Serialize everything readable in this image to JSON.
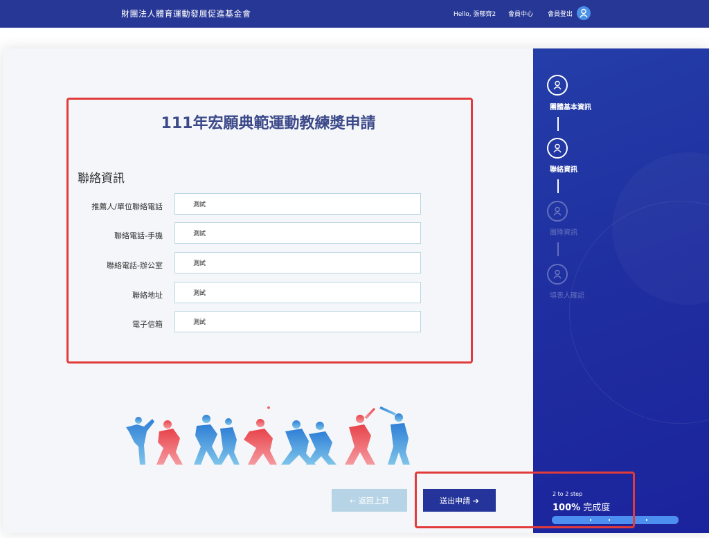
{
  "header": {
    "brand": "財團法人體育運動發展促進基金會",
    "greeting": "Hello, 張郁齊2",
    "member_center": "會員中心",
    "logout": "會員登出"
  },
  "form": {
    "title": "111年宏願典範運動教練獎申請",
    "section": "聯絡資訊",
    "fields": [
      {
        "label": "推薦人/單位聯絡電話",
        "value": "測試"
      },
      {
        "label": "聯絡電話-手機",
        "value": "測試"
      },
      {
        "label": "聯絡電話-辦公室",
        "value": "測試"
      },
      {
        "label": "聯絡地址",
        "value": "測試"
      },
      {
        "label": "電子信箱",
        "value": "測試"
      }
    ]
  },
  "buttons": {
    "back": "← 返回上頁",
    "submit": "送出申請 ➔"
  },
  "steps": [
    {
      "label": "團體基本資訊",
      "state": "done"
    },
    {
      "label": "聯絡資訊",
      "state": "current"
    },
    {
      "label": "團隊資訊",
      "state": "inactive"
    },
    {
      "label": "填表人確認",
      "state": "inactive"
    }
  ],
  "progress": {
    "caption": "2 to 2 step",
    "percent_text": "100%",
    "suffix": " 完成度",
    "value": 1.0
  },
  "colors": {
    "header_bg": "#273795",
    "sidebar_bg": "#1f2fa0",
    "submit_bg": "#24349a",
    "back_bg": "#b6d4e6",
    "highlight": "#e23b3b"
  }
}
